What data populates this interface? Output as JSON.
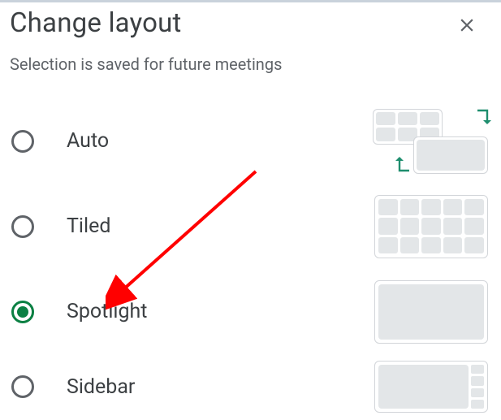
{
  "dialog": {
    "title": "Change layout",
    "subtitle": "Selection is saved for future meetings"
  },
  "options": [
    {
      "key": "auto",
      "label": "Auto",
      "selected": false
    },
    {
      "key": "tiled",
      "label": "Tiled",
      "selected": false
    },
    {
      "key": "spotlight",
      "label": "Spotlight",
      "selected": true
    },
    {
      "key": "sidebar",
      "label": "Sidebar",
      "selected": false
    }
  ],
  "icons": {
    "close": "close-icon"
  },
  "annotation": {
    "color": "#ff0000",
    "target_option": "spotlight"
  }
}
